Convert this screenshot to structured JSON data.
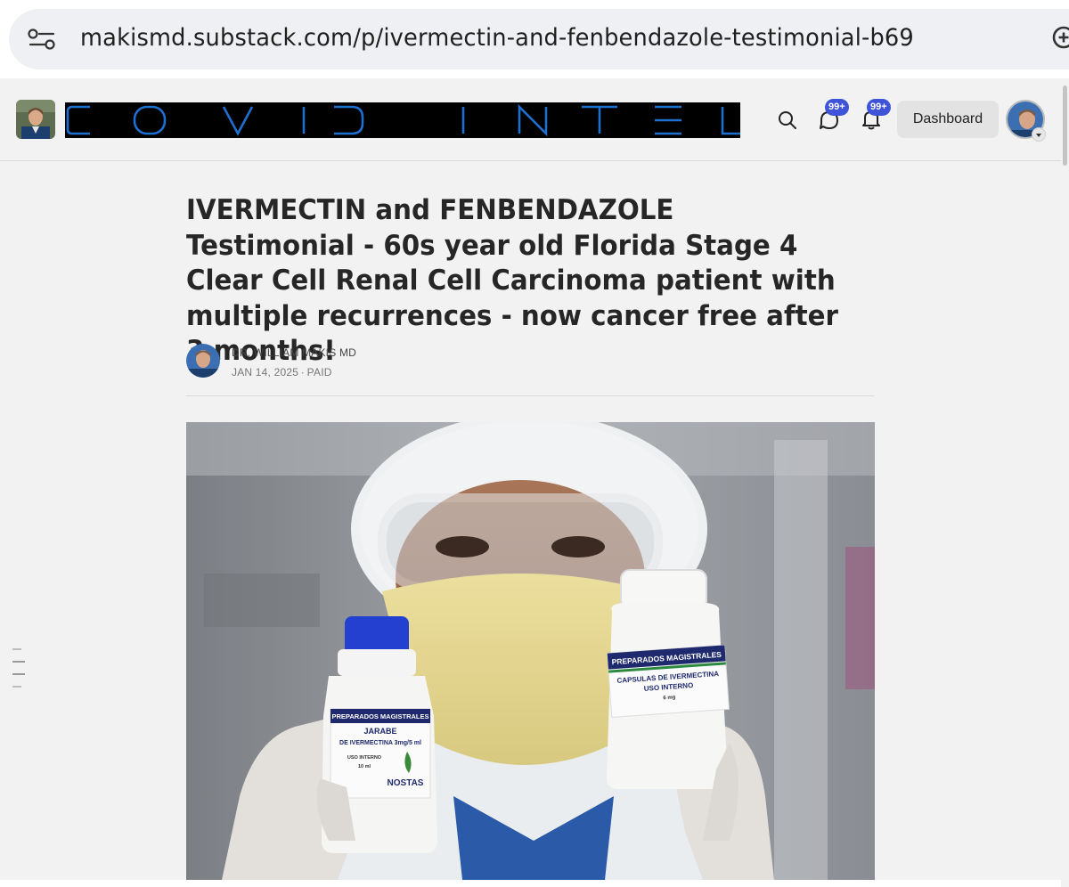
{
  "browser": {
    "url": "makismd.substack.com/p/ivermectin-and-fenbendazole-testimonial-b69",
    "icons": {
      "site_settings": "tune-icon",
      "zoom": "zoom-in-icon"
    }
  },
  "nav": {
    "publication_banner": "COVID INTEL",
    "chat_badge": "99+",
    "notifications_badge": "99+",
    "dashboard_label": "Dashboard",
    "icons": {
      "search": "search-icon",
      "chat": "chat-bubble-icon",
      "notifications": "bell-icon",
      "account_menu": "chevron-down-icon"
    }
  },
  "post": {
    "title": "IVERMECTIN and FENBENDAZOLE Testimonial - 60s year old Florida Stage 4 Clear Cell Renal Cell Carcinoma patient with multiple recurrences - now cancer free after 3 months!",
    "author": "DR. WILLIAM MAKIS MD",
    "date": "JAN 14, 2025",
    "separator": "∙",
    "access": "PAID"
  },
  "hero_image": {
    "left_bottle": {
      "brand": "PREPARADOS MAGISTRALES",
      "line1": "JARABE",
      "line2": "DE IVERMECTINA 3mg/5 ml",
      "line3": "USO INTERNO",
      "line4": "10 ml",
      "logo": "NOSTAS"
    },
    "right_bottle": {
      "brand": "PREPARADOS MAGISTRALES",
      "line1": "CAPSULAS DE IVERMECTINA",
      "line2": "USO INTERNO",
      "line3": "6 mg"
    }
  },
  "colors": {
    "badge": "#3f53d9",
    "banner_text": "#1f6fd1",
    "banner_bg": "#000000"
  }
}
